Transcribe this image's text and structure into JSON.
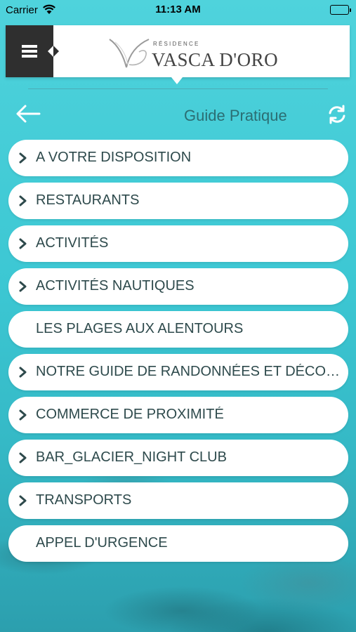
{
  "status_bar": {
    "carrier": "Carrier",
    "time": "11:13 AM"
  },
  "header": {
    "logo_sub": "RÉSIDENCE",
    "logo_name": "VASCA D'ORO"
  },
  "nav": {
    "title": "Guide Pratique"
  },
  "colors": {
    "accent": "#2b6e73",
    "menu_bg": "#2f2f2f",
    "background": "#3cc7d3"
  },
  "list": {
    "items": [
      {
        "label": "A VOTRE DISPOSITION",
        "chevron": true
      },
      {
        "label": "RESTAURANTS",
        "chevron": true
      },
      {
        "label": "ACTIVITÉS",
        "chevron": true
      },
      {
        "label": "ACTIVITÉS NAUTIQUES",
        "chevron": true
      },
      {
        "label": "LES PLAGES AUX ALENTOURS",
        "chevron": false
      },
      {
        "label": "NOTRE GUIDE DE RANDONNÉES ET DÉCOUVERTES",
        "chevron": true
      },
      {
        "label": "COMMERCE DE PROXIMITÉ",
        "chevron": true
      },
      {
        "label": "BAR_GLACIER_NIGHT CLUB",
        "chevron": true
      },
      {
        "label": "TRANSPORTS",
        "chevron": true
      },
      {
        "label": "APPEL D'URGENCE",
        "chevron": false
      }
    ]
  }
}
